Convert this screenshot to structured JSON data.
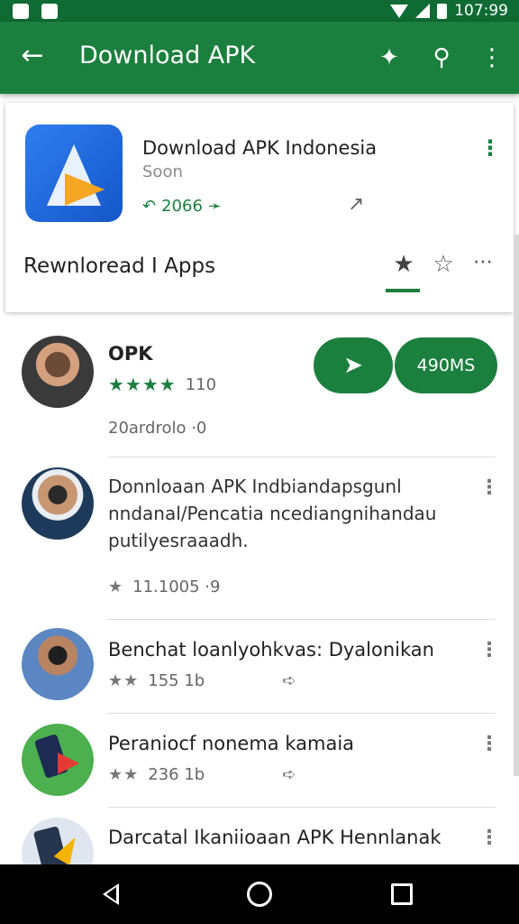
{
  "status": {
    "time": "107:99"
  },
  "appbar": {
    "title": "Download APK",
    "back_icon": "arrow-left-icon",
    "actions": [
      "pin-icon",
      "search-icon",
      "more-vert-icon"
    ]
  },
  "app": {
    "title": "Download APK Indonesia",
    "developer": "Soon",
    "count": "2066",
    "section_label": "Rewnloread I Apps"
  },
  "items": [
    {
      "title": "OPK",
      "rating": "110",
      "subtitle": "20ardrolo ·0",
      "buttons": {
        "primary_icon": "send-icon",
        "secondary_label": "490MS"
      }
    },
    {
      "body": "Donnloaan APK Indbiandapsgunl nndanal/Pencatia ncediangnihandau putilyesraaadh.",
      "meta": "11.1005 ·9"
    },
    {
      "title": "Benchat loanlyohkvas: Dyalonikan",
      "meta": "155 1b"
    },
    {
      "title": "Peraniocf nonema kamaia",
      "meta": "236 1b"
    },
    {
      "title": "Darcatal Ikaniioaan APK Hennlanak"
    }
  ],
  "colors": {
    "brand": "#1b7f3e",
    "statusbar": "#0f6b34"
  }
}
